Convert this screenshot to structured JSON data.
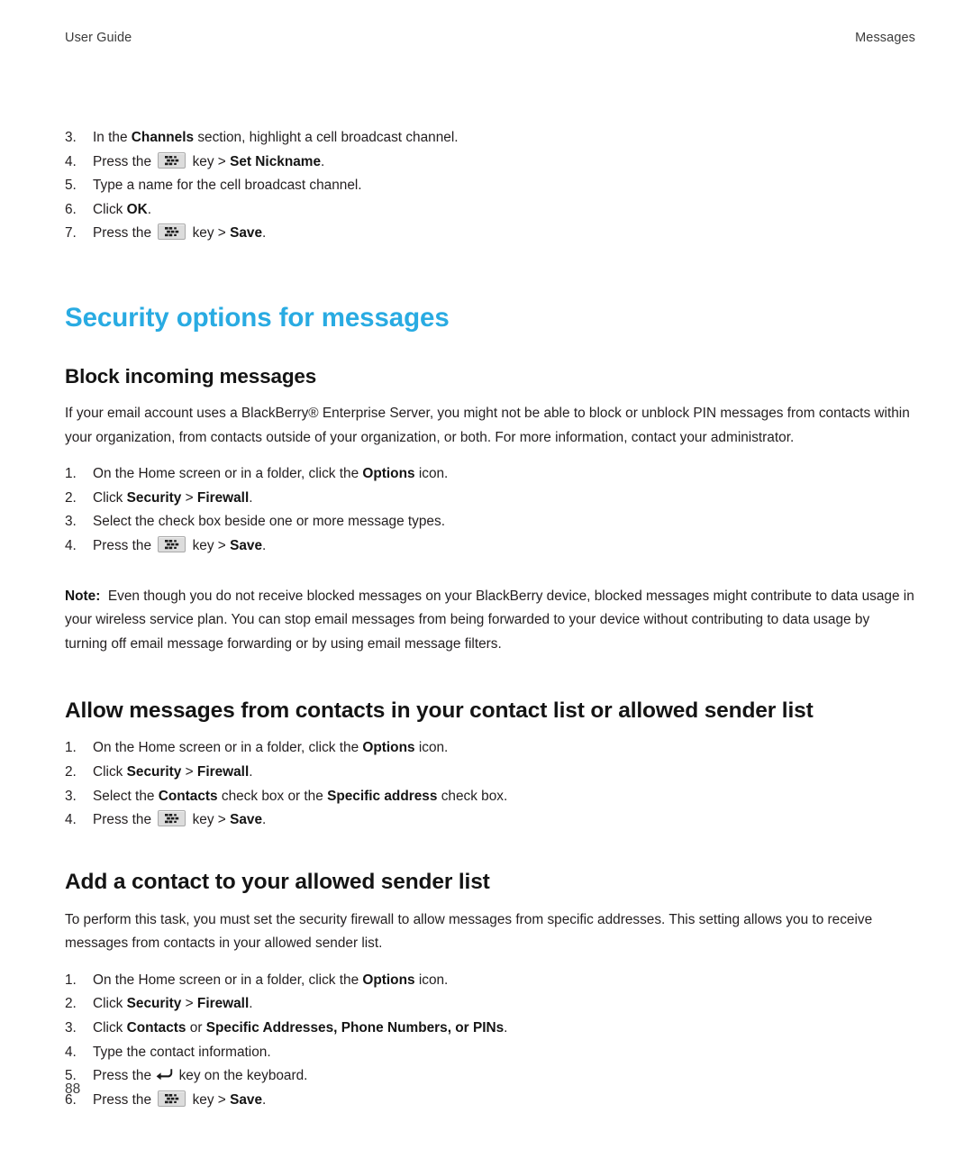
{
  "header": {
    "left": "User Guide",
    "right": "Messages"
  },
  "footer": {
    "page_number": "88"
  },
  "icons": {
    "menu_key": "blackberry-menu-key-icon",
    "enter_key": "enter-key-icon"
  },
  "top_steps": {
    "items": [
      {
        "num": "3.",
        "parts": [
          {
            "t": "In the ",
            "b": false
          },
          {
            "t": "Channels",
            "b": true
          },
          {
            "t": " section, highlight a cell broadcast channel.",
            "b": false
          }
        ]
      },
      {
        "num": "4.",
        "parts": [
          {
            "t": "Press the ",
            "b": false
          },
          {
            "icon": "menu-key"
          },
          {
            "t": " key > ",
            "b": false
          },
          {
            "t": "Set Nickname",
            "b": true
          },
          {
            "t": ".",
            "b": false
          }
        ]
      },
      {
        "num": "5.",
        "parts": [
          {
            "t": "Type a name for the cell broadcast channel.",
            "b": false
          }
        ]
      },
      {
        "num": "6.",
        "parts": [
          {
            "t": "Click ",
            "b": false
          },
          {
            "t": "OK",
            "b": true
          },
          {
            "t": ".",
            "b": false
          }
        ]
      },
      {
        "num": "7.",
        "parts": [
          {
            "t": "Press the ",
            "b": false
          },
          {
            "icon": "menu-key"
          },
          {
            "t": " key > ",
            "b": false
          },
          {
            "t": "Save",
            "b": true
          },
          {
            "t": ".",
            "b": false
          }
        ]
      }
    ]
  },
  "chapter_heading": "Security options for messages",
  "section1": {
    "heading": "Block incoming messages",
    "intro": "If your email account uses a BlackBerry® Enterprise Server, you might not be able to block or unblock PIN messages from contacts within your organization, from contacts outside of your organization, or both. For more information, contact your administrator.",
    "steps": [
      {
        "num": "1.",
        "parts": [
          {
            "t": "On the Home screen or in a folder, click the ",
            "b": false
          },
          {
            "t": "Options",
            "b": true
          },
          {
            "t": " icon.",
            "b": false
          }
        ]
      },
      {
        "num": "2.",
        "parts": [
          {
            "t": "Click ",
            "b": false
          },
          {
            "t": "Security",
            "b": true
          },
          {
            "t": " > ",
            "b": false
          },
          {
            "t": "Firewall",
            "b": true
          },
          {
            "t": ".",
            "b": false
          }
        ]
      },
      {
        "num": "3.",
        "parts": [
          {
            "t": "Select the check box beside one or more message types.",
            "b": false
          }
        ]
      },
      {
        "num": "4.",
        "parts": [
          {
            "t": "Press the ",
            "b": false
          },
          {
            "icon": "menu-key"
          },
          {
            "t": " key > ",
            "b": false
          },
          {
            "t": "Save",
            "b": true
          },
          {
            "t": ".",
            "b": false
          }
        ]
      }
    ],
    "note_label": "Note:",
    "note_text": "Even though you do not receive blocked messages on your BlackBerry device, blocked messages might contribute to data usage in your wireless service plan. You can stop email messages from being forwarded to your device without contributing to data usage by turning off email message forwarding or by using email message filters."
  },
  "section2": {
    "heading": "Allow messages from contacts in your contact list or allowed sender list",
    "steps": [
      {
        "num": "1.",
        "parts": [
          {
            "t": "On the Home screen or in a folder, click the ",
            "b": false
          },
          {
            "t": "Options",
            "b": true
          },
          {
            "t": " icon.",
            "b": false
          }
        ]
      },
      {
        "num": "2.",
        "parts": [
          {
            "t": "Click ",
            "b": false
          },
          {
            "t": "Security",
            "b": true
          },
          {
            "t": " > ",
            "b": false
          },
          {
            "t": "Firewall",
            "b": true
          },
          {
            "t": ".",
            "b": false
          }
        ]
      },
      {
        "num": "3.",
        "parts": [
          {
            "t": "Select the ",
            "b": false
          },
          {
            "t": "Contacts",
            "b": true
          },
          {
            "t": " check box or the ",
            "b": false
          },
          {
            "t": "Specific address",
            "b": true
          },
          {
            "t": " check box.",
            "b": false
          }
        ]
      },
      {
        "num": "4.",
        "parts": [
          {
            "t": "Press the ",
            "b": false
          },
          {
            "icon": "menu-key"
          },
          {
            "t": " key > ",
            "b": false
          },
          {
            "t": "Save",
            "b": true
          },
          {
            "t": ".",
            "b": false
          }
        ]
      }
    ]
  },
  "section3": {
    "heading": "Add a contact to your allowed sender list",
    "intro": "To perform this task, you must set the security firewall to allow messages from specific addresses. This setting allows you to receive messages from contacts in your allowed sender list.",
    "steps": [
      {
        "num": "1.",
        "parts": [
          {
            "t": "On the Home screen or in a folder, click the ",
            "b": false
          },
          {
            "t": "Options",
            "b": true
          },
          {
            "t": " icon.",
            "b": false
          }
        ]
      },
      {
        "num": "2.",
        "parts": [
          {
            "t": "Click ",
            "b": false
          },
          {
            "t": "Security",
            "b": true
          },
          {
            "t": " > ",
            "b": false
          },
          {
            "t": "Firewall",
            "b": true
          },
          {
            "t": ".",
            "b": false
          }
        ]
      },
      {
        "num": "3.",
        "parts": [
          {
            "t": "Click ",
            "b": false
          },
          {
            "t": "Contacts",
            "b": true
          },
          {
            "t": " or ",
            "b": false
          },
          {
            "t": "Specific Addresses, Phone Numbers, or PINs",
            "b": true
          },
          {
            "t": ".",
            "b": false
          }
        ]
      },
      {
        "num": "4.",
        "parts": [
          {
            "t": "Type the contact information.",
            "b": false
          }
        ]
      },
      {
        "num": "5.",
        "parts": [
          {
            "t": "Press the ",
            "b": false
          },
          {
            "icon": "enter-key"
          },
          {
            "t": " key on the keyboard.",
            "b": false
          }
        ]
      },
      {
        "num": "6.",
        "parts": [
          {
            "t": "Press the ",
            "b": false
          },
          {
            "icon": "menu-key"
          },
          {
            "t": " key > ",
            "b": false
          },
          {
            "t": "Save",
            "b": true
          },
          {
            "t": ".",
            "b": false
          }
        ]
      }
    ]
  },
  "colors": {
    "chapter_heading": "#29abe2",
    "body_text": "#231f20",
    "key_face": "#dcdcdc"
  }
}
